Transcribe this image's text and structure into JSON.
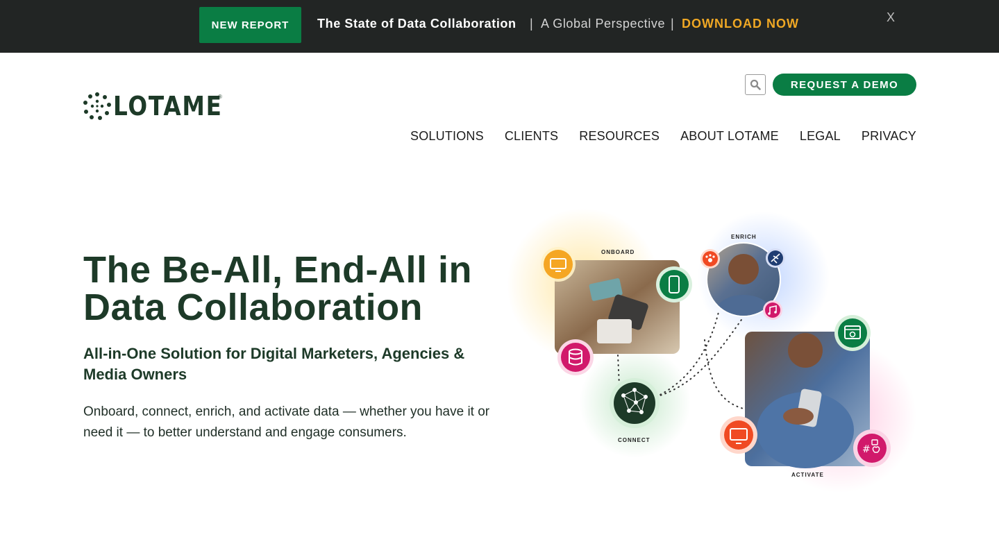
{
  "banner": {
    "badge": "NEW REPORT",
    "title": "The State of Data Collaboration",
    "separator": "|",
    "subtitle": "A Global Perspective",
    "cta": "DOWNLOAD NOW",
    "close": "X"
  },
  "header": {
    "logo_text": "LOTAME",
    "logo_mark": "®",
    "demo_button": "REQUEST A DEMO",
    "nav": [
      "SOLUTIONS",
      "CLIENTS",
      "RESOURCES",
      "ABOUT LOTAME",
      "LEGAL",
      "PRIVACY"
    ]
  },
  "hero": {
    "title": "The Be-All, End-All in Data Collaboration",
    "subtitle": "All-in-One Solution for Digital Marketers, Agencies & Media Owners",
    "body": "Onboard, connect, enrich, and activate data — whether you have it or need it — to better understand and engage consumers."
  },
  "illustration": {
    "labels": {
      "onboard": "ONBOARD",
      "enrich": "ENRICH",
      "connect": "CONNECT",
      "activate": "ACTIVATE"
    }
  },
  "colors": {
    "brand_green": "#0a7d44",
    "dark_green": "#1d3a28",
    "banner_bg": "#222524",
    "accent_orange": "#f0a824"
  }
}
